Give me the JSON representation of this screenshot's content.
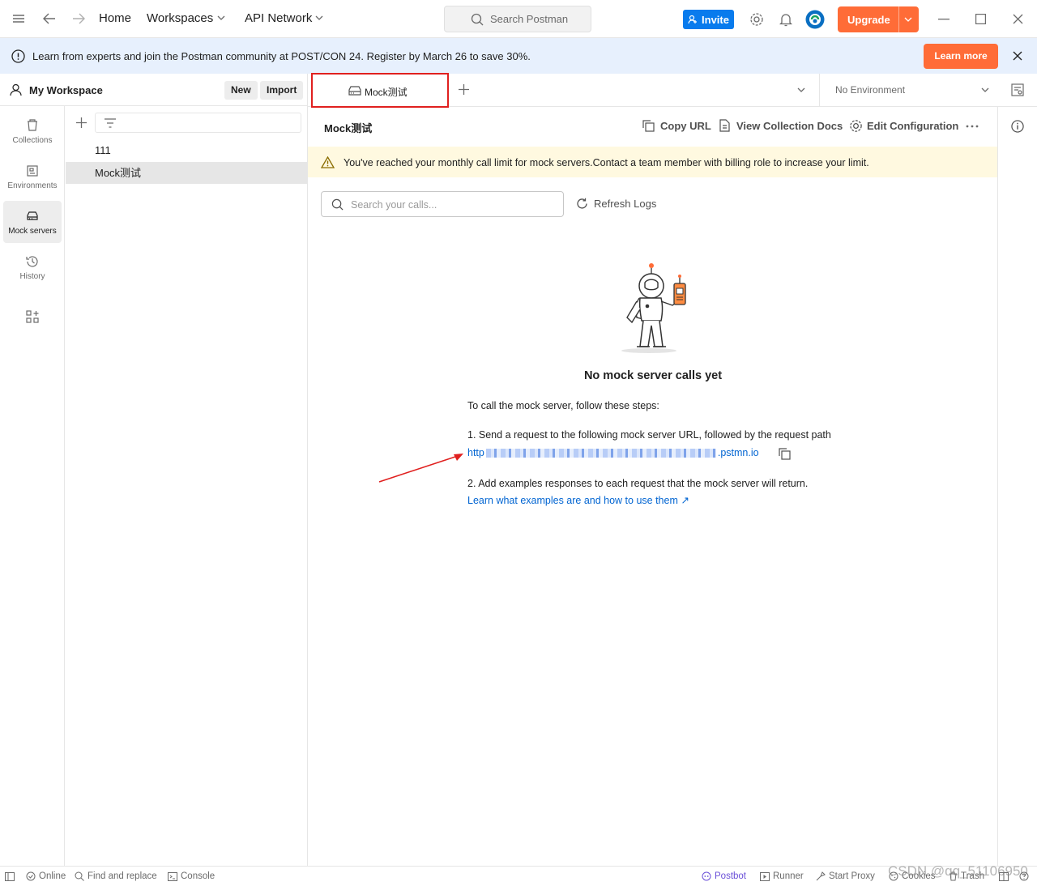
{
  "titlebar": {
    "home": "Home",
    "workspaces": "Workspaces",
    "api_network": "API Network",
    "search_placeholder": "Search Postman",
    "invite": "Invite",
    "upgrade": "Upgrade"
  },
  "banner": {
    "message": "Learn from experts and join the Postman community at POST/CON 24. Register by March 26 to save 30%.",
    "learn_more": "Learn more"
  },
  "workspace": {
    "name": "My Workspace",
    "new": "New",
    "import": "Import"
  },
  "nav": [
    {
      "label": "Collections"
    },
    {
      "label": "Environments"
    },
    {
      "label": "Mock servers"
    },
    {
      "label": "History"
    }
  ],
  "mock_list": [
    "111",
    "Mock测试"
  ],
  "tabs": {
    "active": "Mock测试",
    "environment": "No Environment"
  },
  "content": {
    "title": "Mock测试",
    "copy_url": "Copy URL",
    "view_docs": "View Collection Docs",
    "edit_config": "Edit Configuration",
    "warning": "You've reached your monthly call limit for mock servers.Contact a team member with billing role to increase your limit.",
    "search_placeholder": "Search your calls...",
    "refresh": "Refresh Logs",
    "empty_title": "No mock server calls yet",
    "intro": "To call the mock server, follow these steps:",
    "step1": "1. Send a request to the following mock server URL, followed by the request path",
    "url_prefix": "http",
    "url_suffix": ".pstmn.io",
    "step2": "2. Add examples responses to each request that the mock server will return.",
    "examples_link": "Learn what examples are and how to use them ↗"
  },
  "statusbar": {
    "online": "Online",
    "find_replace": "Find and replace",
    "console": "Console",
    "postbot": "Postbot",
    "runner": "Runner",
    "start_proxy": "Start Proxy",
    "cookies": "Cookies",
    "trash": "Trash"
  },
  "watermark": "CSDN @qq_51106950",
  "colors": {
    "accent": "#ff6c37",
    "invite_blue": "#097bed",
    "banner_bg": "#e7f0fd",
    "warning_bg": "#fff9e0",
    "highlight_red": "#e0201f"
  }
}
